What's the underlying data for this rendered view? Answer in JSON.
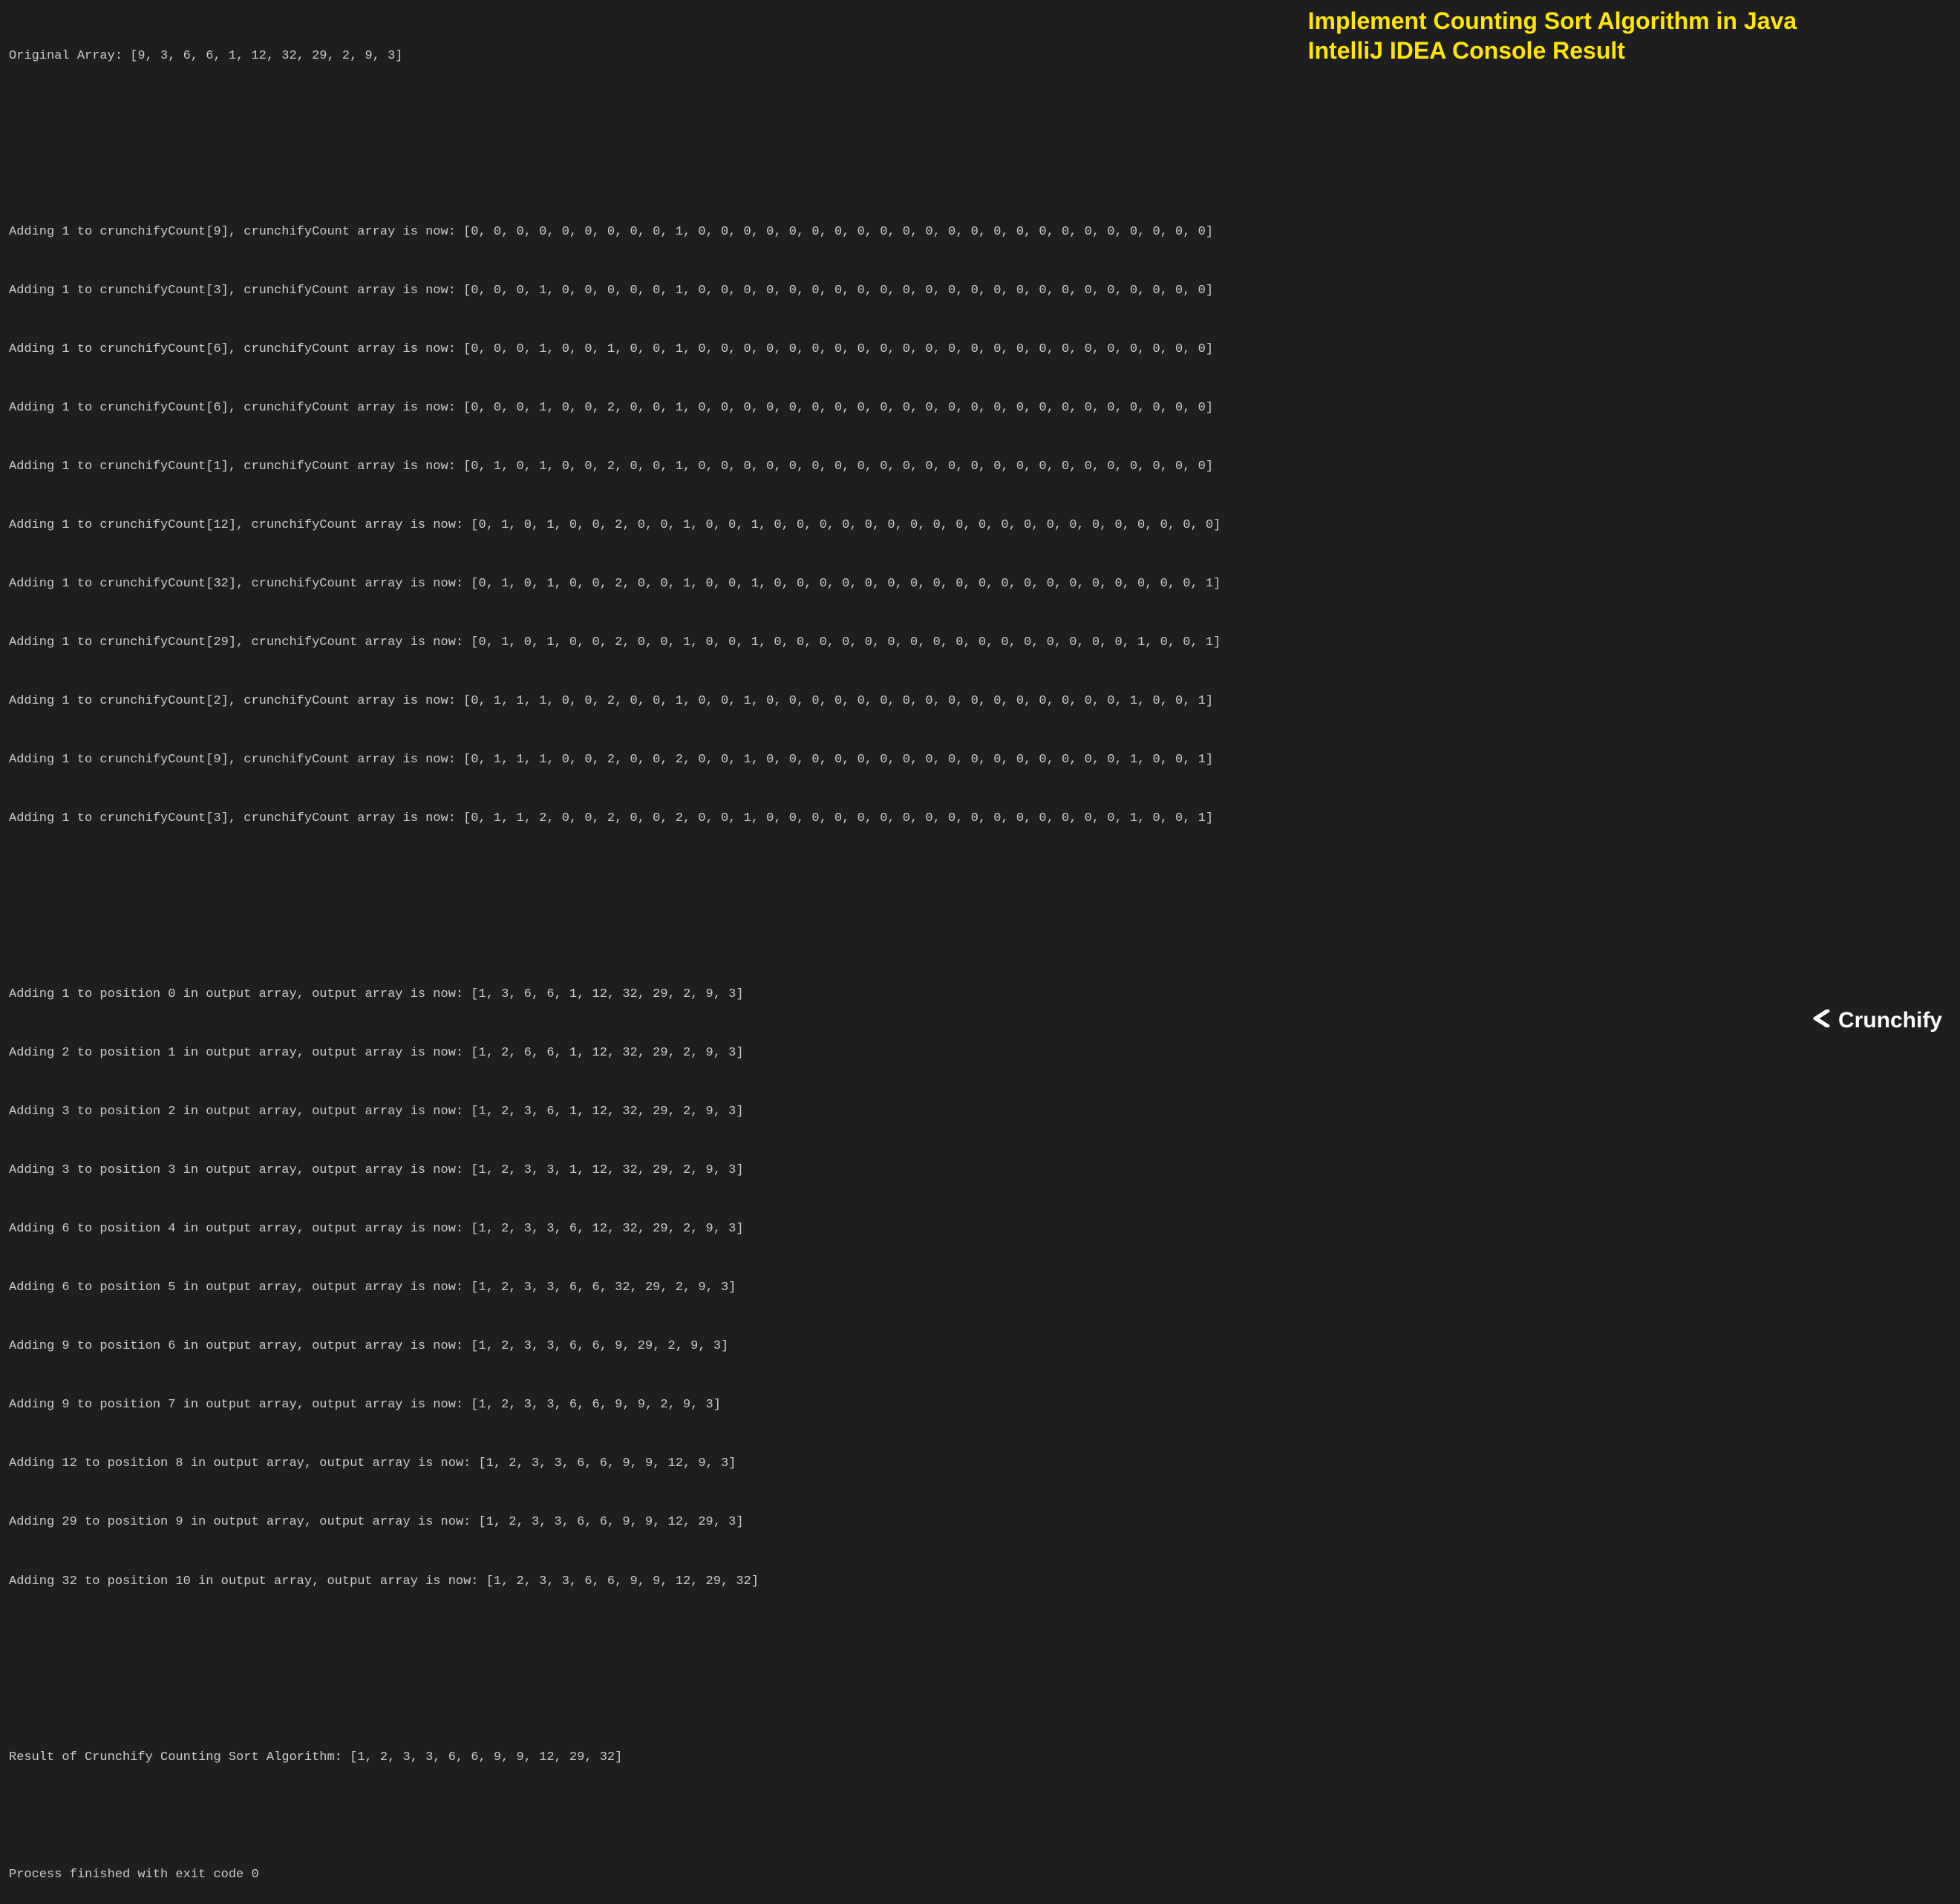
{
  "title": {
    "line1": "Implement Counting Sort Algorithm in Java",
    "line2": "IntelliJ IDEA Console Result"
  },
  "footer": {
    "brand": "Crunchify"
  },
  "console": {
    "originalArray": "Original Array: [9, 3, 6, 6, 1, 12, 32, 29, 2, 9, 3]",
    "countLines": [
      "Adding 1 to crunchifyCount[9], crunchifyCount array is now: [0, 0, 0, 0, 0, 0, 0, 0, 0, 1, 0, 0, 0, 0, 0, 0, 0, 0, 0, 0, 0, 0, 0, 0, 0, 0, 0, 0, 0, 0, 0, 0, 0]",
      "Adding 1 to crunchifyCount[3], crunchifyCount array is now: [0, 0, 0, 1, 0, 0, 0, 0, 0, 1, 0, 0, 0, 0, 0, 0, 0, 0, 0, 0, 0, 0, 0, 0, 0, 0, 0, 0, 0, 0, 0, 0, 0]",
      "Adding 1 to crunchifyCount[6], crunchifyCount array is now: [0, 0, 0, 1, 0, 0, 1, 0, 0, 1, 0, 0, 0, 0, 0, 0, 0, 0, 0, 0, 0, 0, 0, 0, 0, 0, 0, 0, 0, 0, 0, 0, 0]",
      "Adding 1 to crunchifyCount[6], crunchifyCount array is now: [0, 0, 0, 1, 0, 0, 2, 0, 0, 1, 0, 0, 0, 0, 0, 0, 0, 0, 0, 0, 0, 0, 0, 0, 0, 0, 0, 0, 0, 0, 0, 0, 0]",
      "Adding 1 to crunchifyCount[1], crunchifyCount array is now: [0, 1, 0, 1, 0, 0, 2, 0, 0, 1, 0, 0, 0, 0, 0, 0, 0, 0, 0, 0, 0, 0, 0, 0, 0, 0, 0, 0, 0, 0, 0, 0, 0]",
      "Adding 1 to crunchifyCount[12], crunchifyCount array is now: [0, 1, 0, 1, 0, 0, 2, 0, 0, 1, 0, 0, 1, 0, 0, 0, 0, 0, 0, 0, 0, 0, 0, 0, 0, 0, 0, 0, 0, 0, 0, 0, 0]",
      "Adding 1 to crunchifyCount[32], crunchifyCount array is now: [0, 1, 0, 1, 0, 0, 2, 0, 0, 1, 0, 0, 1, 0, 0, 0, 0, 0, 0, 0, 0, 0, 0, 0, 0, 0, 0, 0, 0, 0, 0, 0, 1]",
      "Adding 1 to crunchifyCount[29], crunchifyCount array is now: [0, 1, 0, 1, 0, 0, 2, 0, 0, 1, 0, 0, 1, 0, 0, 0, 0, 0, 0, 0, 0, 0, 0, 0, 0, 0, 0, 0, 0, 1, 0, 0, 1]",
      "Adding 1 to crunchifyCount[2], crunchifyCount array is now: [0, 1, 1, 1, 0, 0, 2, 0, 0, 1, 0, 0, 1, 0, 0, 0, 0, 0, 0, 0, 0, 0, 0, 0, 0, 0, 0, 0, 0, 1, 0, 0, 1]",
      "Adding 1 to crunchifyCount[9], crunchifyCount array is now: [0, 1, 1, 1, 0, 0, 2, 0, 0, 2, 0, 0, 1, 0, 0, 0, 0, 0, 0, 0, 0, 0, 0, 0, 0, 0, 0, 0, 0, 1, 0, 0, 1]",
      "Adding 1 to crunchifyCount[3], crunchifyCount array is now: [0, 1, 1, 2, 0, 0, 2, 0, 0, 2, 0, 0, 1, 0, 0, 0, 0, 0, 0, 0, 0, 0, 0, 0, 0, 0, 0, 0, 0, 1, 0, 0, 1]"
    ],
    "outputLines": [
      "Adding 1 to position 0 in output array, output array is now: [1, 3, 6, 6, 1, 12, 32, 29, 2, 9, 3]",
      "Adding 2 to position 1 in output array, output array is now: [1, 2, 6, 6, 1, 12, 32, 29, 2, 9, 3]",
      "Adding 3 to position 2 in output array, output array is now: [1, 2, 3, 6, 1, 12, 32, 29, 2, 9, 3]",
      "Adding 3 to position 3 in output array, output array is now: [1, 2, 3, 3, 1, 12, 32, 29, 2, 9, 3]",
      "Adding 6 to position 4 in output array, output array is now: [1, 2, 3, 3, 6, 12, 32, 29, 2, 9, 3]",
      "Adding 6 to position 5 in output array, output array is now: [1, 2, 3, 3, 6, 6, 32, 29, 2, 9, 3]",
      "Adding 9 to position 6 in output array, output array is now: [1, 2, 3, 3, 6, 6, 9, 29, 2, 9, 3]",
      "Adding 9 to position 7 in output array, output array is now: [1, 2, 3, 3, 6, 6, 9, 9, 2, 9, 3]",
      "Adding 12 to position 8 in output array, output array is now: [1, 2, 3, 3, 6, 6, 9, 9, 12, 9, 3]",
      "Adding 29 to position 9 in output array, output array is now: [1, 2, 3, 3, 6, 6, 9, 9, 12, 29, 3]",
      "Adding 32 to position 10 in output array, output array is now: [1, 2, 3, 3, 6, 6, 9, 9, 12, 29, 32]"
    ],
    "resultLine": "Result of Crunchify Counting Sort Algorithm: [1, 2, 3, 3, 6, 6, 9, 9, 12, 29, 32]",
    "exitLine": "Process finished with exit code 0"
  }
}
